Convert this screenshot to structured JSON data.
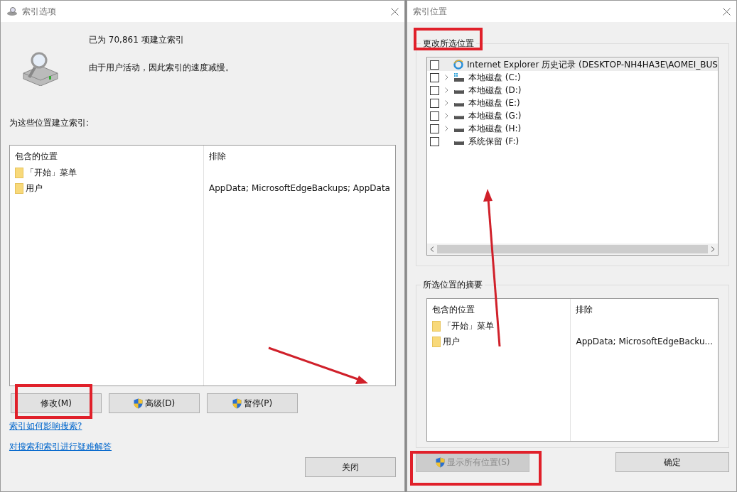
{
  "left_dialog": {
    "title": "索引选项",
    "index_count": "已为 70,861 项建立索引",
    "status": "由于用户活动，因此索引的速度减慢。",
    "section_label": "为这些位置建立索引:",
    "table": {
      "columns": [
        "包含的位置",
        "排除"
      ],
      "rows": [
        {
          "location": "「开始」菜单",
          "exclude": ""
        },
        {
          "location": "用户",
          "exclude": "AppData; MicrosoftEdgeBackups; AppData"
        }
      ]
    },
    "buttons": [
      {
        "label": "修改(M)",
        "shield": false
      },
      {
        "label": "高级(D)",
        "shield": true
      },
      {
        "label": "暂停(P)",
        "shield": true
      }
    ],
    "links": [
      "索引如何影响搜索?",
      "对搜索和索引进行疑难解答"
    ],
    "close_button": "关闭"
  },
  "right_dialog": {
    "title": "索引位置",
    "group_label": "更改所选位置",
    "tree": [
      {
        "label": "Internet Explorer 历史记录 (DESKTOP-NH4HA3E\\AOMEI_BUS",
        "kind": "browser",
        "checked": false,
        "expandable": false
      },
      {
        "label": "本地磁盘 (C:)",
        "kind": "system_drive",
        "checked": false,
        "expandable": true
      },
      {
        "label": "本地磁盘 (D:)",
        "kind": "drive",
        "checked": false,
        "expandable": true
      },
      {
        "label": "本地磁盘 (E:)",
        "kind": "drive",
        "checked": false,
        "expandable": true
      },
      {
        "label": "本地磁盘 (G:)",
        "kind": "drive",
        "checked": false,
        "expandable": true
      },
      {
        "label": "本地磁盘 (H:)",
        "kind": "drive",
        "checked": false,
        "expandable": true
      },
      {
        "label": "系统保留 (F:)",
        "kind": "drive",
        "checked": false,
        "expandable": false
      }
    ],
    "summary_label": "所选位置的摘要",
    "summary_table": {
      "columns": [
        "包含的位置",
        "排除"
      ],
      "rows": [
        {
          "location": "「开始」菜单",
          "exclude": ""
        },
        {
          "location": "用户",
          "exclude": "AppData; MicrosoftEdgeBacku..."
        }
      ]
    },
    "buttons": [
      {
        "label": "显示所有位置(S)",
        "shield": true,
        "disabled": true
      },
      {
        "label": "确定",
        "shield": false,
        "disabled": false
      }
    ]
  }
}
